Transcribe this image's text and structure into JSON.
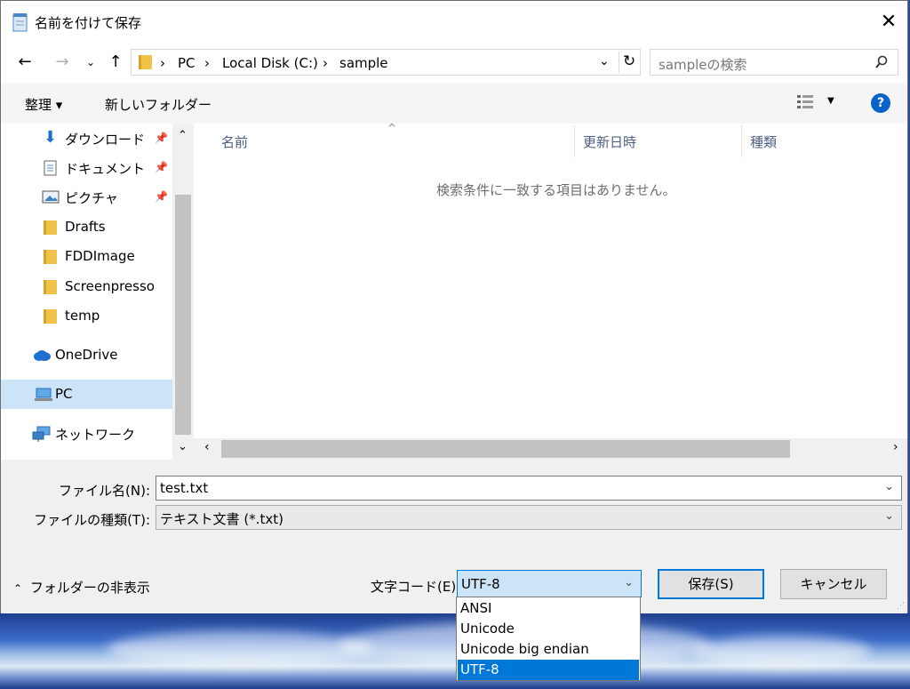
{
  "window": {
    "title": "名前を付けて保存"
  },
  "nav": {
    "breadcrumbs": [
      "PC",
      "Local Disk (C:)",
      "sample"
    ],
    "search_placeholder": "sampleの検索"
  },
  "toolbar": {
    "organize": "整理 ▾",
    "new_folder": "新しいフォルダー",
    "help": "?"
  },
  "sidebar": {
    "items": [
      {
        "label": "ダウンロード",
        "icon": "download-arrow-icon",
        "pinned": true
      },
      {
        "label": "ドキュメント",
        "icon": "document-icon",
        "pinned": true
      },
      {
        "label": "ピクチャ",
        "icon": "picture-icon",
        "pinned": true
      },
      {
        "label": "Drafts",
        "icon": "folder-icon"
      },
      {
        "label": "FDDImage",
        "icon": "folder-icon"
      },
      {
        "label": "Screenpresso",
        "icon": "folder-icon"
      },
      {
        "label": "temp",
        "icon": "folder-icon"
      },
      {
        "label": "OneDrive",
        "icon": "cloud-icon"
      },
      {
        "label": "PC",
        "icon": "computer-icon",
        "selected": true
      },
      {
        "label": "ネットワーク",
        "icon": "network-icon"
      }
    ]
  },
  "list": {
    "columns": [
      "名前",
      "更新日時",
      "種類"
    ],
    "empty_message": "検索条件に一致する項目はありません。"
  },
  "form": {
    "filename_label": "ファイル名(N):",
    "filename_value": "test.txt",
    "filetype_label": "ファイルの種類(T):",
    "filetype_value": "テキスト文書 (*.txt)",
    "encoding_label": "文字コード(E):",
    "encoding_value": "UTF-8",
    "hide_folders": "フォルダーの非表示",
    "save": "保存(S)",
    "cancel": "キャンセル"
  },
  "encoding_options": [
    "ANSI",
    "Unicode",
    "Unicode big endian",
    "UTF-8"
  ],
  "colors": {
    "accent": "#0078d7",
    "selection": "#cce4f7",
    "folder": "#f1c24a"
  }
}
